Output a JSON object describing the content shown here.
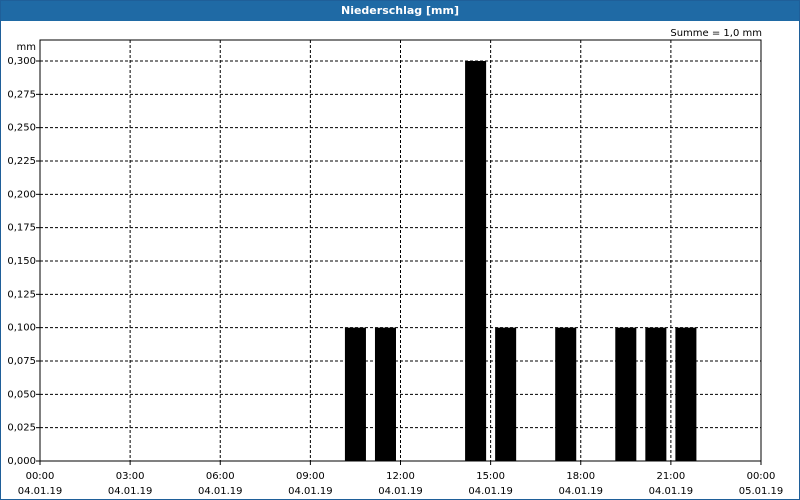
{
  "window": {
    "title": "Niederschlag [mm]"
  },
  "chart_data": {
    "type": "bar",
    "title": "Niederschlag [mm]",
    "ylabel": "mm",
    "annotation": "Summe = 1,0 mm",
    "grid": true,
    "xlim_hours": [
      0,
      24
    ],
    "ylim": [
      0,
      0.3
    ],
    "y_ticks": [
      {
        "v": 0.0,
        "label": "0,000"
      },
      {
        "v": 0.025,
        "label": "0,025"
      },
      {
        "v": 0.05,
        "label": "0,050"
      },
      {
        "v": 0.075,
        "label": "0,075"
      },
      {
        "v": 0.1,
        "label": "0,100"
      },
      {
        "v": 0.125,
        "label": "0,125"
      },
      {
        "v": 0.15,
        "label": "0,150"
      },
      {
        "v": 0.175,
        "label": "0,175"
      },
      {
        "v": 0.2,
        "label": "0,200"
      },
      {
        "v": 0.225,
        "label": "0,225"
      },
      {
        "v": 0.25,
        "label": "0,250"
      },
      {
        "v": 0.275,
        "label": "0,275"
      },
      {
        "v": 0.3,
        "label": "0,300"
      }
    ],
    "x_ticks": [
      {
        "h": 0,
        "time": "00:00",
        "date": "04.01.19"
      },
      {
        "h": 3,
        "time": "03:00",
        "date": "04.01.19"
      },
      {
        "h": 6,
        "time": "06:00",
        "date": "04.01.19"
      },
      {
        "h": 9,
        "time": "09:00",
        "date": "04.01.19"
      },
      {
        "h": 12,
        "time": "12:00",
        "date": "04.01.19"
      },
      {
        "h": 15,
        "time": "15:00",
        "date": "04.01.19"
      },
      {
        "h": 18,
        "time": "18:00",
        "date": "04.01.19"
      },
      {
        "h": 21,
        "time": "21:00",
        "date": "04.01.19"
      },
      {
        "h": 24,
        "time": "00:00",
        "date": "05.01.19"
      }
    ],
    "bars": [
      {
        "start": "10:00",
        "end": "11:00",
        "value": 0.1
      },
      {
        "start": "11:00",
        "end": "12:00",
        "value": 0.1
      },
      {
        "start": "14:00",
        "end": "15:00",
        "value": 0.3
      },
      {
        "start": "15:00",
        "end": "16:00",
        "value": 0.1
      },
      {
        "start": "17:00",
        "end": "18:00",
        "value": 0.1
      },
      {
        "start": "19:00",
        "end": "20:00",
        "value": 0.1
      },
      {
        "start": "20:00",
        "end": "21:00",
        "value": 0.1
      },
      {
        "start": "21:00",
        "end": "22:00",
        "value": 0.1
      }
    ],
    "bar_color": "#000000"
  }
}
